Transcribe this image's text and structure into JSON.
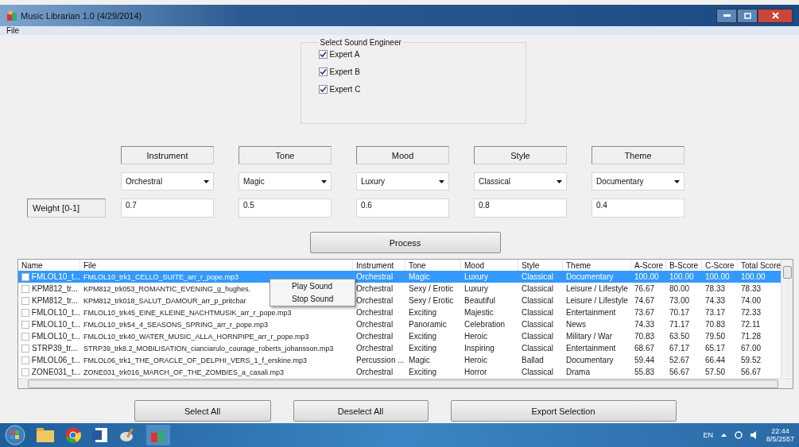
{
  "window": {
    "title": "Music Librarian 1.0 (4/29/2014)"
  },
  "menu": [
    "File"
  ],
  "engineer_group": {
    "title": "Select Sound Engineer",
    "options": [
      {
        "label": "Expert A",
        "checked": true
      },
      {
        "label": "Expert B",
        "checked": true
      },
      {
        "label": "Expert C",
        "checked": true
      }
    ]
  },
  "criteria": [
    {
      "heading": "Instrument",
      "choice": "Orchestral",
      "weight": "0.7"
    },
    {
      "heading": "Tone",
      "choice": "Magic",
      "weight": "0.5"
    },
    {
      "heading": "Mood",
      "choice": "Luxury",
      "weight": "0.6"
    },
    {
      "heading": "Style",
      "choice": "Classical",
      "weight": "0.8"
    },
    {
      "heading": "Theme",
      "choice": "Documentary",
      "weight": "0.4"
    }
  ],
  "weight_label": "Weight [0-1]",
  "process_button": "Process",
  "table": {
    "columns": [
      "Name",
      "File",
      "Instrument",
      "Tone",
      "Mood",
      "Style",
      "Theme",
      "A-Score",
      "B-Score",
      "C-Score",
      "Total Score"
    ],
    "rows": [
      {
        "checked": false,
        "selected": true,
        "cells": [
          "FMLOL10_t...",
          "FMLOL10_trk1_CELLO_SUITE_arr_r_pope.mp3",
          "Orchestral",
          "Magic",
          "Luxury",
          "Classical",
          "Documentary",
          "100.00",
          "100.00",
          "100.00",
          "100.00"
        ]
      },
      {
        "checked": false,
        "selected": false,
        "cells": [
          "KPM812_tr...",
          "KPM812_trk053_ROMANTIC_EVENING_g_hughes.",
          "Orchestral",
          "Sexy / Erotic",
          "Luxury",
          "Classical",
          "Leisure / Lifestyle",
          "76.67",
          "80.00",
          "78.33",
          "78.33"
        ]
      },
      {
        "checked": false,
        "selected": false,
        "cells": [
          "KPM812_tr...",
          "KPM812_trk018_SALUT_DAMOUR_arr_p_pritchar",
          "Orchestral",
          "Sexy / Erotic",
          "Beautiful",
          "Classical",
          "Leisure / Lifestyle",
          "74.67",
          "73.00",
          "74.33",
          "74.00"
        ]
      },
      {
        "checked": false,
        "selected": false,
        "cells": [
          "FMLOL10_t...",
          "FMLOL10_trk45_EINE_KLEINE_NACHTMUSIK_arr_r_pope.mp3",
          "Orchestral",
          "Exciting",
          "Majestic",
          "Classical",
          "Entertainment",
          "73.67",
          "70.17",
          "73.17",
          "72.33"
        ]
      },
      {
        "checked": false,
        "selected": false,
        "cells": [
          "FMLOL10_t...",
          "FMLOL10_trk54_4_SEASONS_SPRING_arr_r_pope.mp3",
          "Orchestral",
          "Panoramic",
          "Celebration",
          "Classical",
          "News",
          "74.33",
          "71.17",
          "70.83",
          "72.11"
        ]
      },
      {
        "checked": false,
        "selected": false,
        "cells": [
          "FMLOL10_t...",
          "FMLOL10_trk40_WATER_MUSIC_ALLA_HORNPIPE_arr_r_pope.mp3",
          "Orchestral",
          "Exciting",
          "Heroic",
          "Classical",
          "Military / War",
          "70.83",
          "63.50",
          "79.50",
          "71.28"
        ]
      },
      {
        "checked": false,
        "selected": false,
        "cells": [
          "STRP39_tr...",
          "STRP39_trk8.2_MOBILISATION_cianciarulo_courage_roberts_johansson.mp3",
          "Orchestral",
          "Exciting",
          "Inspiring",
          "Classical",
          "Entertainment",
          "68.67",
          "67.17",
          "65.17",
          "67.00"
        ]
      },
      {
        "checked": false,
        "selected": false,
        "cells": [
          "FMLOL06_t...",
          "FMLOL06_trk1_THE_ORACLE_OF_DELPHI_VERS_1_f_erskine.mp3",
          "Percussion ...",
          "Magic",
          "Heroic",
          "Ballad",
          "Documentary",
          "59.44",
          "52.67",
          "66.44",
          "59.52"
        ]
      },
      {
        "checked": false,
        "selected": false,
        "cells": [
          "ZONE031_t...",
          "ZONE031_trk016_MARCH_OF_THE_ZOMBIES_a_casali.mp3",
          "Orchestral",
          "Exciting",
          "Horror",
          "Classical",
          "Drama",
          "55.83",
          "56.67",
          "57.50",
          "56.67"
        ]
      }
    ]
  },
  "context_menu": [
    "Play Sound",
    "Stop Sound"
  ],
  "buttons": [
    "Select All",
    "Deselect All",
    "Export Selection"
  ],
  "taskbar": {
    "language": "EN",
    "time": "22:44",
    "date": "8/5/2557"
  }
}
